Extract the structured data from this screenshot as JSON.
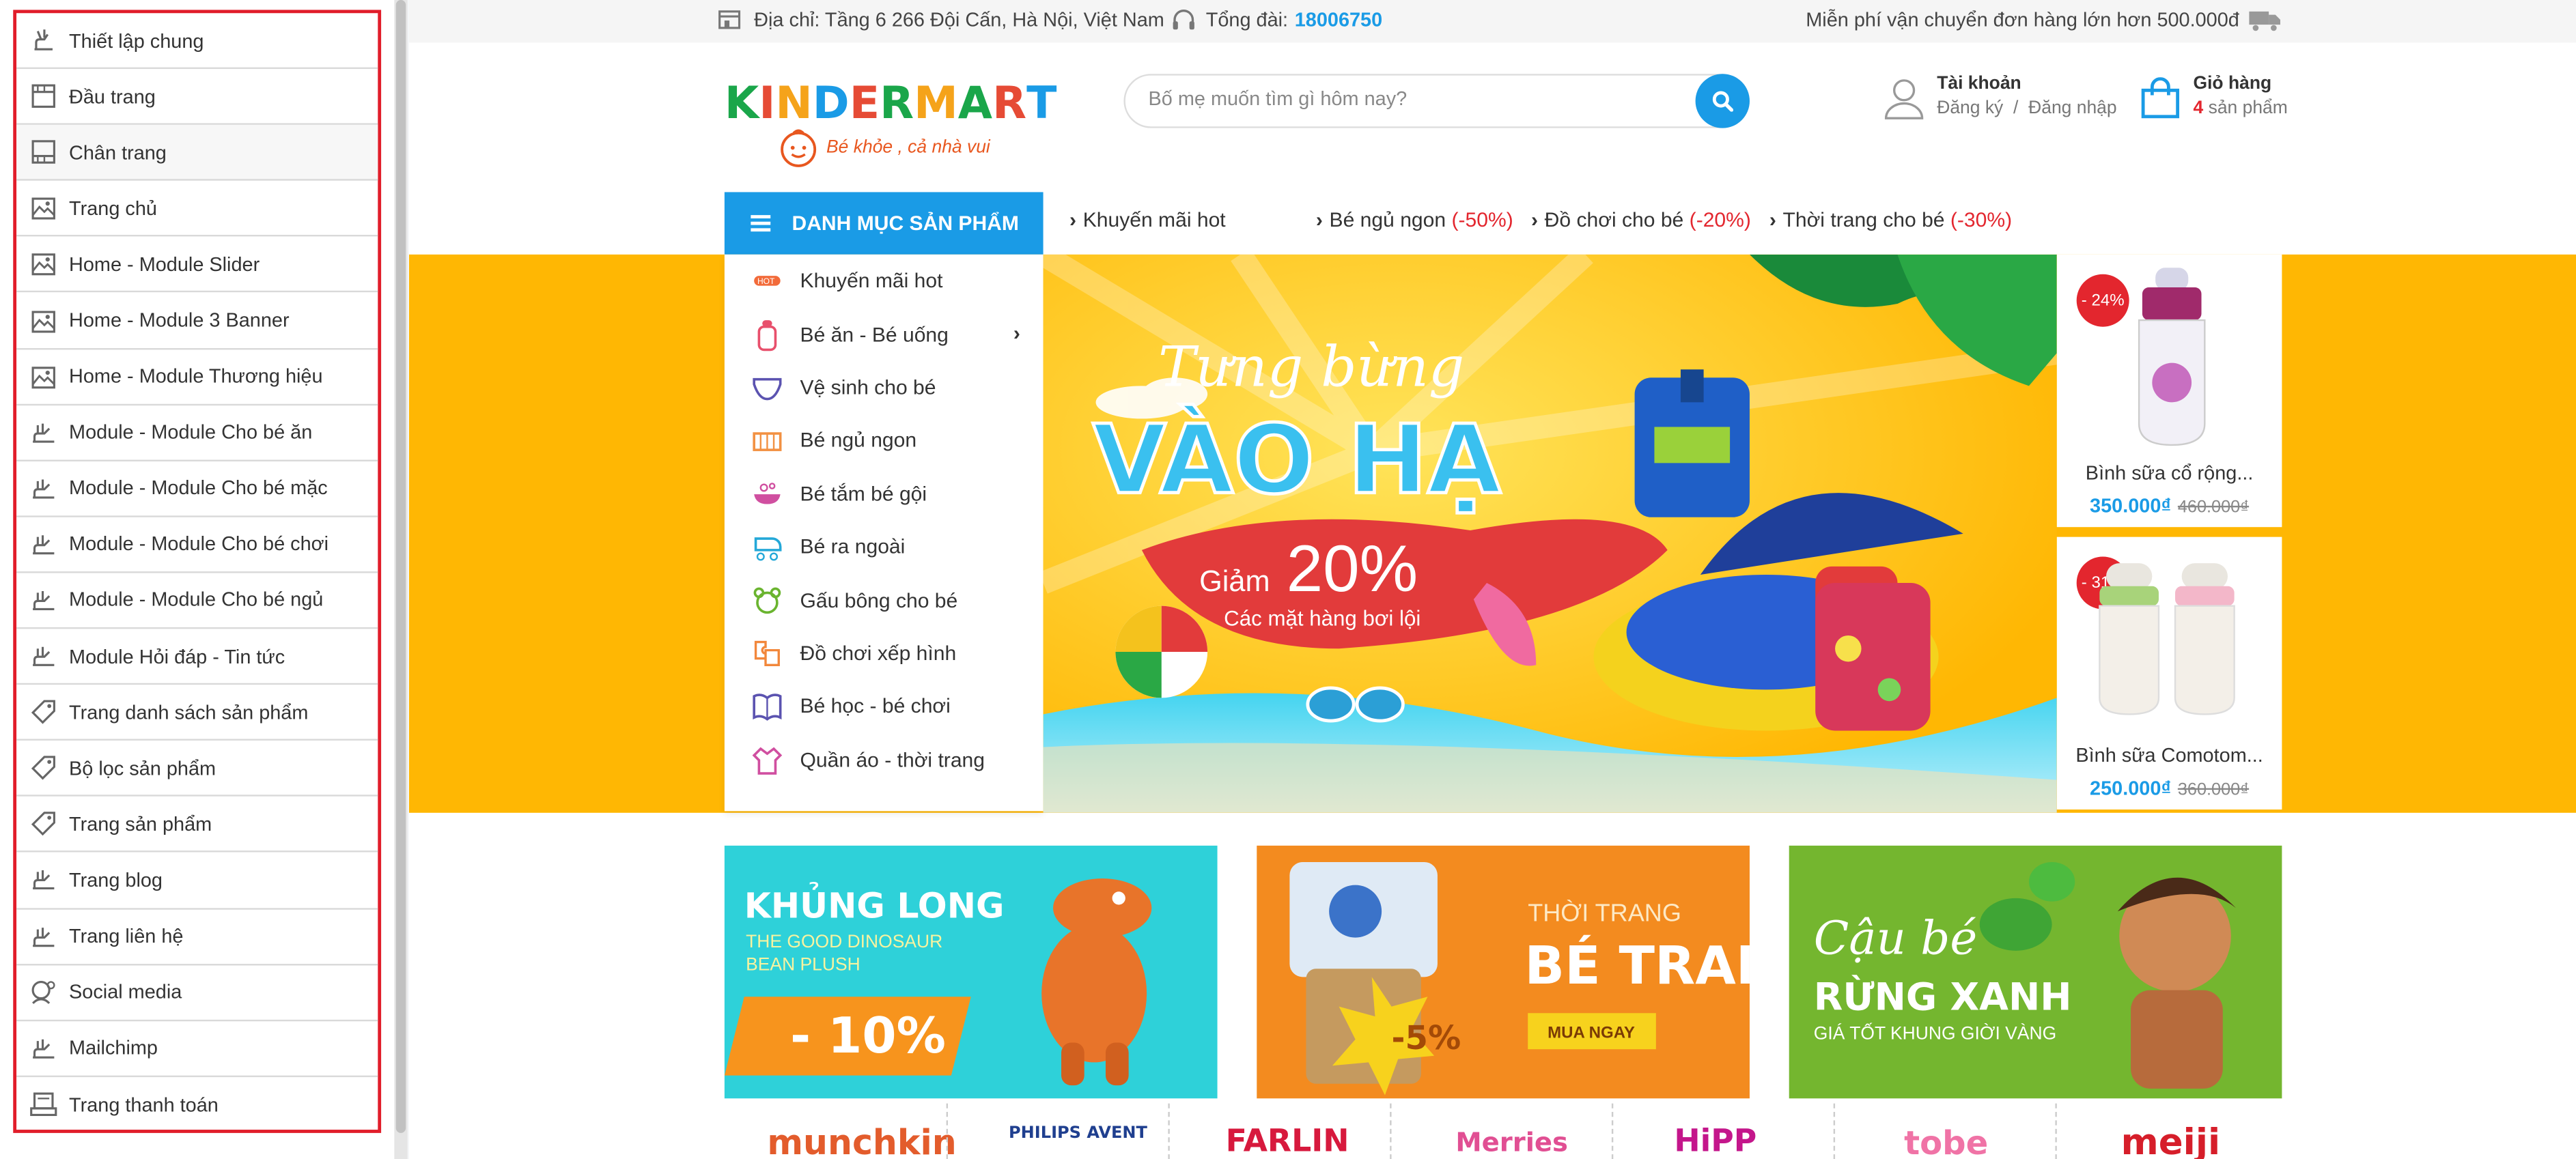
{
  "sidebar": {
    "items": [
      {
        "label": "Thiết lập chung",
        "icon": "settings-hand-icon"
      },
      {
        "label": "Đầu trang",
        "icon": "header-icon"
      },
      {
        "label": "Chân trang",
        "icon": "footer-icon"
      },
      {
        "label": "Trang chủ",
        "icon": "home-image-icon"
      },
      {
        "label": "Home - Module Slider",
        "icon": "home-image-icon"
      },
      {
        "label": "Home - Module 3 Banner",
        "icon": "home-image-icon"
      },
      {
        "label": "Home - Module Thương hiệu",
        "icon": "home-image-icon"
      },
      {
        "label": "Module - Module Cho bé ăn",
        "icon": "module-hand-icon"
      },
      {
        "label": "Module - Module Cho bé mặc",
        "icon": "module-hand-icon"
      },
      {
        "label": "Module - Module Cho bé chơi",
        "icon": "module-hand-icon"
      },
      {
        "label": "Module - Module Cho bé ngủ",
        "icon": "module-hand-icon"
      },
      {
        "label": "Module Hỏi đáp - Tin tức",
        "icon": "module-hand-icon"
      },
      {
        "label": "Trang danh sách sản phẩm",
        "icon": "tag-icon"
      },
      {
        "label": "Bộ lọc sản phẩm",
        "icon": "tag-icon"
      },
      {
        "label": "Trang sản phẩm",
        "icon": "tag-icon"
      },
      {
        "label": "Trang blog",
        "icon": "module-hand-icon"
      },
      {
        "label": "Trang liên hệ",
        "icon": "module-hand-icon"
      },
      {
        "label": "Social media",
        "icon": "social-icon"
      },
      {
        "label": "Mailchimp",
        "icon": "module-hand-icon"
      },
      {
        "label": "Trang thanh toán",
        "icon": "payment-icon"
      }
    ]
  },
  "topbar": {
    "address": "Địa chỉ: Tầng 6 266 Đội Cấn, Hà Nội, Việt Nam",
    "hotline_label": "Tổng đài:",
    "hotline_number": "18006750",
    "shipping": "Miễn phí vận chuyển đơn hàng lớn hơn 500.000đ"
  },
  "header": {
    "logo_text": "KINDER MART",
    "logo_slogan": "Bé khỏe , cả nhà vui",
    "search_placeholder": "Bố mẹ muốn tìm gì hôm nay?",
    "account_title": "Tài khoản",
    "account_register": "Đăng ký",
    "account_sep": "/",
    "account_login": "Đăng nhập",
    "cart_title": "Giỏ hàng",
    "cart_count": "4",
    "cart_unit": "sản phẩm"
  },
  "nav": {
    "menu_label": "DANH MỤC SẢN PHẨM",
    "links": [
      {
        "text": "Khuyến mãi hot",
        "discount": ""
      },
      {
        "text": "Bé ngủ ngon",
        "discount": "(-50%)"
      },
      {
        "text": "Đồ chơi cho bé",
        "discount": "(-20%)"
      },
      {
        "text": "Thời trang cho bé",
        "discount": "(-30%)"
      }
    ]
  },
  "categories": [
    {
      "label": "Khuyến mãi hot",
      "icon": "hot-icon"
    },
    {
      "label": "Bé ăn - Bé uống",
      "icon": "bottle-icon"
    },
    {
      "label": "Vệ sinh cho bé",
      "icon": "diaper-icon"
    },
    {
      "label": "Bé ngủ ngon",
      "icon": "crib-icon"
    },
    {
      "label": "Bé tắm bé gội",
      "icon": "bath-icon"
    },
    {
      "label": "Bé ra ngoài",
      "icon": "stroller-icon"
    },
    {
      "label": "Gấu bông cho bé",
      "icon": "teddy-icon"
    },
    {
      "label": "Đồ chơi xếp hình",
      "icon": "puzzle-icon"
    },
    {
      "label": "Bé học - bé chơi",
      "icon": "book-icon"
    },
    {
      "label": "Quần áo - thời trang",
      "icon": "clothes-icon"
    }
  ],
  "banner": {
    "line1": "Tưng bừng",
    "line2": "VÀO HẠ",
    "discount_prefix": "Giảm",
    "discount_value": "20%",
    "discount_note": "Các mặt hàng bơi lội"
  },
  "products": [
    {
      "name": "Bình sữa cổ rộng...",
      "price": "350.000₫",
      "old_price": "460.000₫",
      "badge": "- 24%"
    },
    {
      "name": "Bình sữa Comotom...",
      "price": "250.000₫",
      "old_price": "360.000₫",
      "badge": "- 31%"
    }
  ],
  "promos": [
    {
      "title": "KHỦNG LONG",
      "sub1": "THE GOOD DINOSAUR",
      "sub2": "BEAN PLUSH",
      "discount": "- 10%",
      "color": "#2ed1d9"
    },
    {
      "title_small": "THỜI TRANG",
      "title": "BÉ TRAI",
      "cta": "MUA NGAY",
      "discount": "-5%",
      "color": "#f38b1f"
    },
    {
      "title_script": "Cậu bé",
      "title": "RỪNG XANH",
      "sub": "GIÁ TỐT KHUNG GIỜI VÀNG",
      "color": "#74b62f"
    }
  ],
  "brands": [
    "munchkin",
    "PHILIPS AVENT",
    "FARLIN",
    "Merries",
    "HiPP",
    "tobe",
    "meiji"
  ],
  "colors": {
    "accent": "#1a9be6",
    "sale": "#e3262e",
    "band": "#ffb703",
    "sidebar_highlight": "#e11d2a"
  }
}
